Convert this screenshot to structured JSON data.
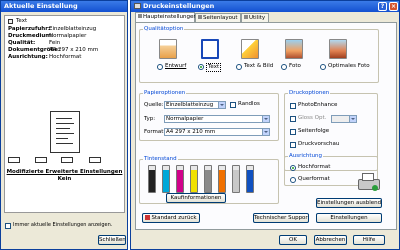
{
  "left_window": {
    "title": "Aktuelle Einstellung",
    "text_label": "Text",
    "rows": [
      {
        "label": "Papierzufuhr:",
        "value": "Einzelblatteinzug"
      },
      {
        "label": "Druckmedium:",
        "value": "Normalpapier"
      },
      {
        "label": "Qualität:",
        "value": "Fein"
      },
      {
        "label": "Dokumentgröße:",
        "value": "A4 297 x 210 mm"
      },
      {
        "label": "Ausrichtung:",
        "value": "Hochformat"
      }
    ],
    "modified_heading": "Modifizierte Erweiterte Einstellungen",
    "modified_value": "Kein",
    "always_show_label": "Immer aktuelle Einstellungen anzeigen.",
    "close_button": "Schließen"
  },
  "right_window": {
    "title": "Druckeinstellungen",
    "tabs": [
      "Haupteinstellungen",
      "Seitenlayout",
      "Utility"
    ],
    "quality_group": "Qualitätoption",
    "quality_options": [
      "Entwurf",
      "Text",
      "Text & Bild",
      "Foto",
      "Optimales Foto"
    ],
    "quality_selected": "Text",
    "paper_group": "Papieroptionen",
    "source_label": "Quelle:",
    "source_value": "Einzelblatteinzug",
    "borderless_label": "Randlos",
    "type_label": "Typ:",
    "type_value": "Normalpapier",
    "format_label": "Format:",
    "format_value": "A4 297 x 210 mm",
    "print_group": "Druckoptionen",
    "print_options": [
      "PhotoEnhance",
      "Gloss Opt.",
      "Seitenfolge",
      "Druckvorschau"
    ],
    "ink_group": "Tintenstand",
    "ink_levels": [
      0.85,
      0.85,
      0.85,
      0.85,
      0.85,
      0.85,
      0.85,
      0.85
    ],
    "ink_colors": [
      "#222222",
      "#00a8d8",
      "#d0008a",
      "#f0e000",
      "#8a8a8a",
      "#f07000",
      "#c8c8c8",
      "#1050c0"
    ],
    "ink_info_button": "Kaufinformationen",
    "orientation_group": "Ausrichtung",
    "portrait_label": "Hochformat",
    "landscape_label": "Querformat",
    "hide_settings_button": "Einstellungen ausblenden",
    "settings_button": "Einstellungen",
    "default_button": "Standard zurück",
    "support_button": "Technischer Support",
    "ok_button": "OK",
    "cancel_button": "Abbrechen",
    "help_button": "Hilfe"
  }
}
